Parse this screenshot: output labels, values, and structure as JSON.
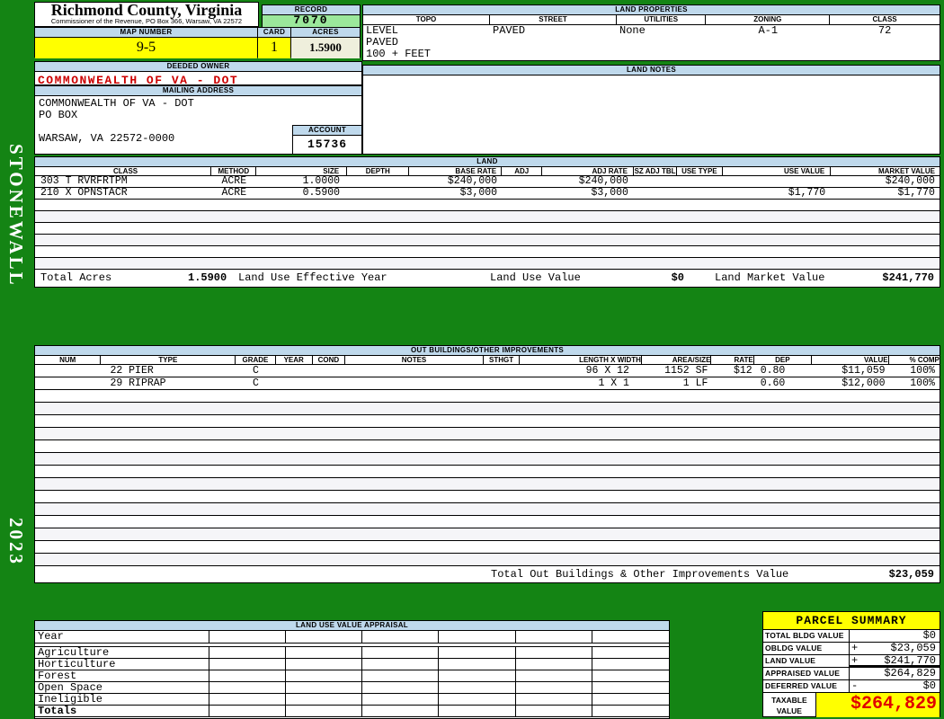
{
  "colors": {
    "background_green": "#148414",
    "header_blue": "#BFD9EC",
    "record_green": "#9BE89B",
    "highlight_yellow": "#FFFF00",
    "acres_cream": "#EFEFDC",
    "owner_red": "#CC0000",
    "taxable_red": "#E00000"
  },
  "sidebar": {
    "district": "STONEWALL",
    "year": "2023"
  },
  "header": {
    "county": "Richmond County, Virginia",
    "commissioner": "Commissioner of the Revenue, PO Box 366, Warsaw, VA 22572",
    "record_label": "RECORD",
    "record": "7070",
    "map_number_label": "MAP NUMBER",
    "map_number": "9-5",
    "card_label": "CARD",
    "card": "1",
    "acres_label": "ACRES",
    "acres": "1.5900"
  },
  "land_properties": {
    "title": "LAND PROPERTIES",
    "headers": [
      "TOPO",
      "STREET",
      "UTILITIES",
      "ZONING",
      "CLASS"
    ],
    "topo_lines": [
      "LEVEL",
      "PAVED",
      "100 + FEET"
    ],
    "street": "PAVED",
    "utilities": "None",
    "zoning": "A-1",
    "class": "72"
  },
  "owner": {
    "deeded_owner_label": "DEEDED OWNER",
    "deeded_owner": "COMMONWEALTH OF VA - DOT",
    "mailing_address_label": "MAILING ADDRESS",
    "address_lines": [
      "COMMONWEALTH OF VA - DOT",
      "PO BOX",
      "",
      "WARSAW, VA 22572-0000"
    ],
    "account_label": "ACCOUNT",
    "account": "15736"
  },
  "land_notes": {
    "title": "LAND NOTES"
  },
  "land": {
    "title": "LAND",
    "headers": [
      "CLASS",
      "METHOD",
      "SIZE",
      "DEPTH",
      "BASE RATE",
      "ADJ",
      "ADJ RATE",
      "SZ ADJ TBL",
      "USE TYPE",
      "USE VALUE",
      "MARKET VALUE"
    ],
    "rows": [
      {
        "class": "303 T RVRFRTPM",
        "method": "ACRE",
        "size": "1.0000",
        "depth": "",
        "base_rate": "$240,000",
        "adj": "",
        "adj_rate": "$240,000",
        "sz_adj_tbl": "",
        "use_type": "",
        "use_value": "",
        "market_value": "$240,000"
      },
      {
        "class": "210 X OPNSTACR",
        "method": "ACRE",
        "size": "0.5900",
        "depth": "",
        "base_rate": "$3,000",
        "adj": "",
        "adj_rate": "$3,000",
        "sz_adj_tbl": "",
        "use_type": "",
        "use_value": "$1,770",
        "market_value": "$1,770"
      }
    ],
    "totals": {
      "total_acres_label": "Total Acres",
      "total_acres": "1.5900",
      "effective_year_label": "Land Use Effective Year",
      "use_value_label": "Land Use Value",
      "use_value": "$0",
      "market_value_label": "Land Market Value",
      "market_value": "$241,770"
    }
  },
  "out_buildings": {
    "title": "OUT BUILDINGS/OTHER IMPROVEMENTS",
    "headers": [
      "NUM",
      "TYPE",
      "GRADE",
      "YEAR",
      "COND",
      "NOTES",
      "STHGT",
      "LENGTH X WIDTH",
      "AREA/SIZE",
      "RATE",
      "DEP",
      "VALUE",
      "% COMP"
    ],
    "rows": [
      {
        "num": "",
        "type": "22 PIER",
        "grade": "C",
        "year": "",
        "cond": "",
        "notes": "",
        "sthgt": "",
        "length_width": "96 X 12",
        "area_size": "1152 SF",
        "rate": "$12",
        "dep": "0.80",
        "value": "$11,059",
        "pct_comp": "100%"
      },
      {
        "num": "",
        "type": "29 RIPRAP",
        "grade": "C",
        "year": "",
        "cond": "",
        "notes": "",
        "sthgt": "",
        "length_width": "1 X 1",
        "area_size": "1 LF",
        "rate": "",
        "dep": "0.60",
        "value": "$12,000",
        "pct_comp": "100%"
      }
    ],
    "total_label": "Total Out Buildings & Other Improvements Value",
    "total": "$23,059"
  },
  "land_use_appraisal": {
    "title": "LAND USE VALUE APPRAISAL",
    "row_labels": [
      "Year",
      "Agriculture",
      "Horticulture",
      "Forest",
      "Open Space",
      "Ineligible",
      "Totals"
    ]
  },
  "parcel_summary": {
    "title": "PARCEL SUMMARY",
    "rows": [
      {
        "label": "TOTAL BLDG VALUE",
        "op": "",
        "value": "$0"
      },
      {
        "label": "OBLDG VALUE",
        "op": "+",
        "value": "$23,059"
      },
      {
        "label": "LAND VALUE",
        "op": "+",
        "value": "$241,770"
      },
      {
        "label": "APPRAISED VALUE",
        "op": "",
        "value": "$264,829"
      },
      {
        "label": "DEFERRED VALUE",
        "op": "-",
        "value": "$0"
      }
    ],
    "taxable_label_line1": "TAXABLE",
    "taxable_label_line2": "VALUE",
    "taxable": "$264,829"
  }
}
